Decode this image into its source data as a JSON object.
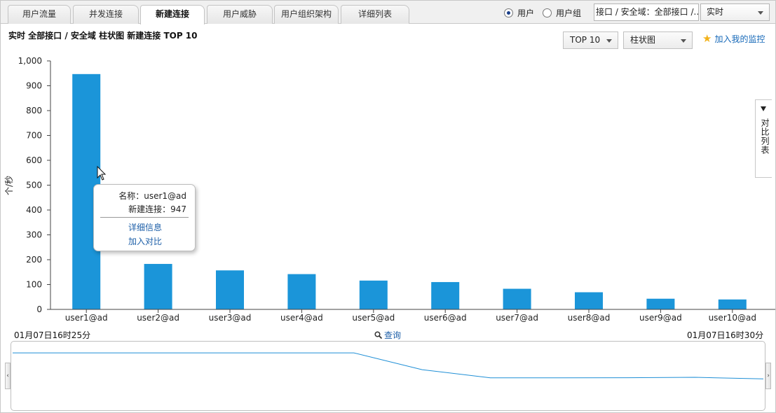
{
  "tabs": [
    "用户流量",
    "并发连接",
    "新建连接",
    "用户威胁",
    "用户组织架构",
    "详细列表"
  ],
  "active_tab": 2,
  "radio": {
    "user_label": "用户",
    "group_label": "用户组",
    "selected": "用户"
  },
  "scope_text": "接口 / 安全域：全部接口 /...",
  "realtime_select": "实时",
  "subtitle": "实时  全部接口 / 安全域  柱状图  新建连接  TOP 10",
  "top_select": "TOP 10",
  "chart_type_select": "柱状图",
  "add_monitor": "加入我的监控",
  "side_tab_label": "对比列表",
  "chart_data": {
    "type": "bar",
    "categories": [
      "user1@ad",
      "user2@ad",
      "user3@ad",
      "user4@ad",
      "user5@ad",
      "user6@ad",
      "user7@ad",
      "user8@ad",
      "user9@ad",
      "user10@ad"
    ],
    "values": [
      947,
      183,
      157,
      142,
      116,
      110,
      83,
      69,
      43,
      40
    ],
    "ylabel": "个/秒",
    "ylim": [
      0,
      1000
    ],
    "yticks": [
      "0",
      "100",
      "200",
      "300",
      "400",
      "500",
      "600",
      "700",
      "800",
      "900",
      "1,000"
    ],
    "bar_color": "#1b95d9",
    "grid": false
  },
  "tooltip": {
    "name_line": "名称：user1@ad",
    "value_line": "新建连接：947",
    "detail_link": "详细信息",
    "compare_link": "加入对比"
  },
  "timeline": {
    "start": "01月07日16时25分",
    "end": "01月07日16时30分",
    "query_label": "查询",
    "trend": [
      947,
      947,
      947,
      947,
      947,
      947,
      640,
      490,
      490,
      492,
      500,
      470
    ],
    "line_color": "#1f8fd6"
  },
  "accent_color": "#1d5fa8"
}
